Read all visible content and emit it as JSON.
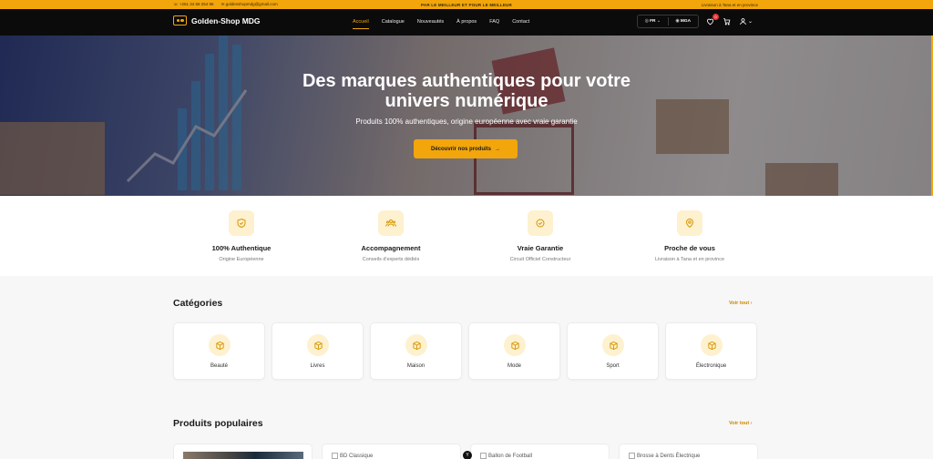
{
  "topbar": {
    "phone": "+261 34 68 254 96",
    "email": "goldenshopmdg@gmail.com",
    "promo": "PAR LE MEILLEUR ET POUR LE MEILLEUR",
    "delivery": "Livraison à Tana et en province",
    "accent": "#f2a60c"
  },
  "nav": {
    "brand": "Golden-Shop MDG",
    "links": [
      "Accueil",
      "Catalogue",
      "Nouveautés",
      "À propos",
      "FAQ",
      "Contact"
    ],
    "active_link": "Accueil",
    "language": "FR",
    "currency": "MGA",
    "wishlist_count": "0"
  },
  "hero": {
    "title_line1": "Des marques authentiques pour votre",
    "title_line2": "univers numérique",
    "subtitle": "Produits 100% authentiques, origine européenne avec vraie garantie",
    "cta": "Découvrir nos produits"
  },
  "features": [
    {
      "title": "100% Authentique",
      "desc": "Origine Européenne",
      "icon": "shield-check-icon"
    },
    {
      "title": "Accompagnement",
      "desc": "Conseils d'experts dédiés",
      "icon": "users-icon"
    },
    {
      "title": "Vraie Garantie",
      "desc": "Circuit Officiel Constructeur",
      "icon": "check-circle-icon"
    },
    {
      "title": "Proche de vous",
      "desc": "Livraison à Tana et en province",
      "icon": "map-pin-icon"
    }
  ],
  "categories": {
    "title": "Catégories",
    "see_all": "Voir tout",
    "items": [
      "Beauté",
      "Livres",
      "Maison",
      "Mode",
      "Sport",
      "Électronique"
    ]
  },
  "products": {
    "title": "Produits populaires",
    "see_all": "Voir tout",
    "items": [
      "",
      "BD Classique",
      "Ballon de Football",
      "Brosse à Dents Électrique"
    ]
  }
}
